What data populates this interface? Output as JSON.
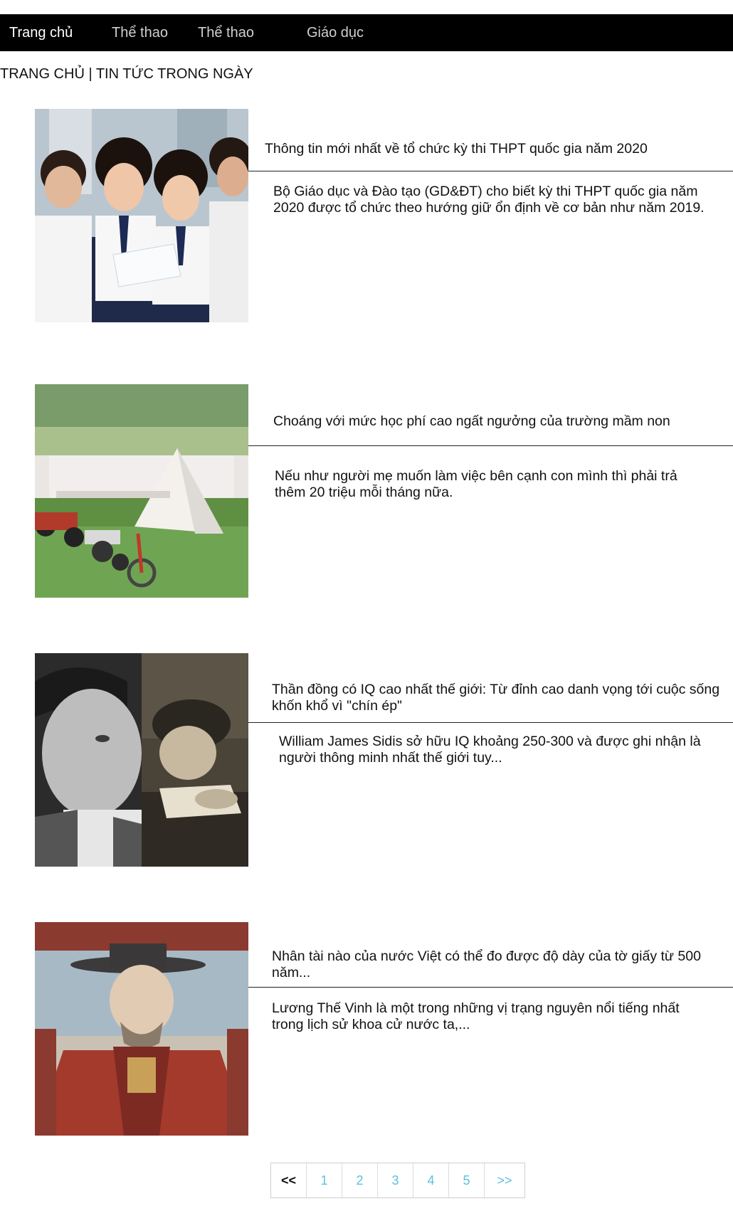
{
  "nav": {
    "items": [
      {
        "label": "Trang chủ",
        "active": true
      },
      {
        "label": "Thể thao",
        "active": false
      },
      {
        "label": "Thể thao",
        "active": false
      },
      {
        "label": "Giáo dục",
        "active": false
      }
    ]
  },
  "breadcrumb": "TRANG CHỦ | TIN TỨC TRONG NGÀY",
  "articles": [
    {
      "title": "Thông tin mới nhất về tổ chức kỳ thi THPT quốc gia năm 2020",
      "summary": "Bộ Giáo dục và Đào tạo (GD&ĐT) cho biết kỳ thi THPT quốc gia năm 2020 được tổ chức theo hướng giữ ổn định về cơ bản như năm 2019."
    },
    {
      "title": "Choáng với mức học phí cao ngất ngưởng của trường mầm non",
      "summary": "Nếu như người mẹ muốn làm việc bên cạnh con mình thì phải trả thêm 20 triệu mỗi tháng nữa."
    },
    {
      "title": "Thần đồng có IQ cao nhất thế giới: Từ đỉnh cao danh vọng tới cuộc sống khốn khổ vì \"chín ép\"",
      "summary": "William James Sidis sở hữu IQ khoảng 250-300 và được ghi nhận là người thông minh nhất thế giới tuy..."
    },
    {
      "title": "Nhân tài nào của nước Việt có thể đo được độ dày của tờ giấy từ 500 năm...",
      "summary": "Lương Thế Vinh là một trong những vị trạng nguyên nổi tiếng nhất trong lịch sử khoa cử nước ta,..."
    }
  ],
  "pagination": {
    "prev": "<<",
    "pages": [
      "1",
      "2",
      "3",
      "4",
      "5"
    ],
    "next": ">>"
  },
  "colors": {
    "navbar_bg": "#000000",
    "pagination_link": "#5bc0de"
  }
}
